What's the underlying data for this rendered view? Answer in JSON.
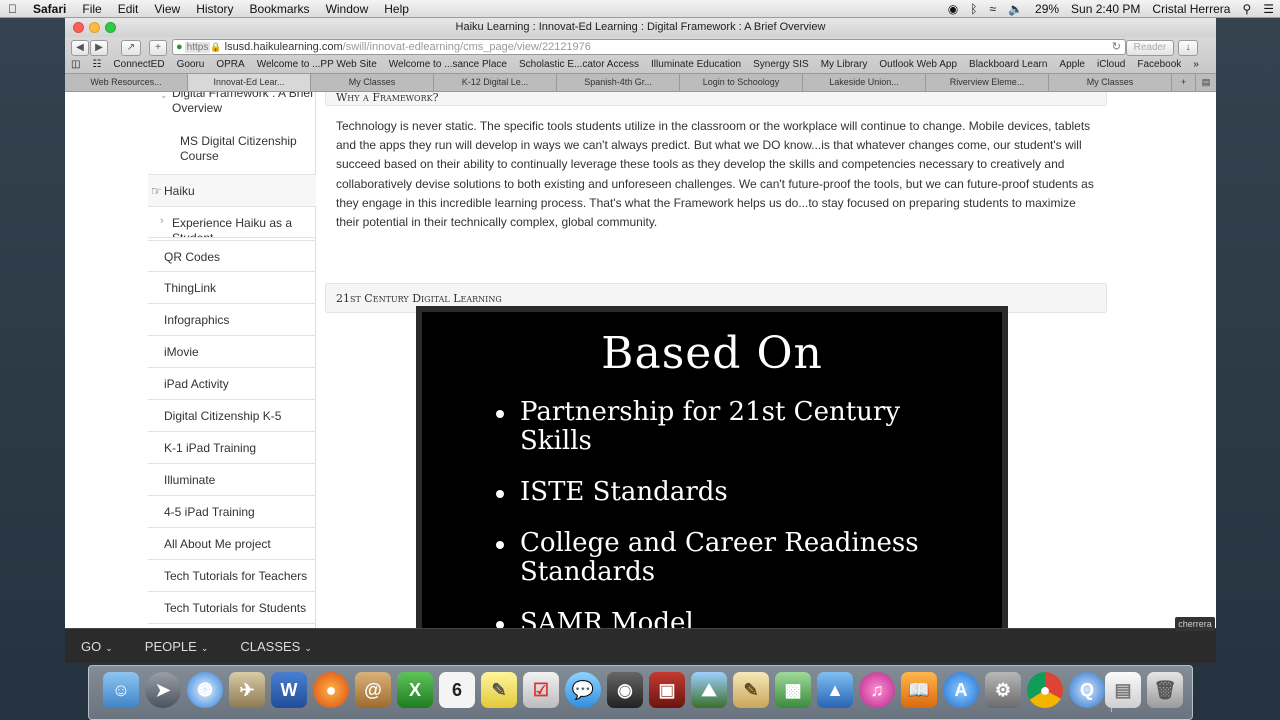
{
  "menubar": {
    "app": "Safari",
    "items": [
      "File",
      "Edit",
      "View",
      "History",
      "Bookmarks",
      "Window",
      "Help"
    ],
    "battery": "29%",
    "clock": "Sun 2:40 PM",
    "user": "Cristal Herrera"
  },
  "window": {
    "title": "Haiku Learning : Innovat-Ed Learning : Digital Framework : A Brief Overview",
    "url_scheme": "https",
    "url_host": "lsusd.haikulearning.com",
    "url_path": "/swill/innovat-edlearning/cms_page/view/22121976",
    "reader_label": "Reader"
  },
  "bookmarks": [
    "ConnectED",
    "Gooru",
    "OPRA",
    "Welcome to ...PP Web Site",
    "Welcome to ...sance Place",
    "Scholastic E...cator Access",
    "Illuminate Education",
    "Synergy SIS",
    "My Library",
    "Outlook Web App",
    "Blackboard Learn",
    "Apple",
    "iCloud",
    "Facebook"
  ],
  "tabs": [
    "Web Resources...",
    "Innovat-Ed Lear...",
    "My Classes",
    "K-12 Digital Le...",
    "Spanish-4th Gr...",
    "Login to Schoology",
    "Lakeside Union...",
    "Riverview Eleme...",
    "My Classes"
  ],
  "nav": {
    "items": [
      "Digital Framework : A Brief Overview",
      "MS Digital Citizenship Course",
      "Haiku",
      "Experience Haiku as a Student",
      "QR Codes",
      "ThingLink",
      "Infographics",
      "iMovie",
      "iPad Activity",
      "Digital Citizenship K-5",
      "K-1 iPad Training",
      "Illuminate",
      "4-5 iPad Training",
      "All About Me project",
      "Tech Tutorials for Teachers",
      "Tech Tutorials for Students"
    ]
  },
  "main": {
    "section1_title": "Why a Framework?",
    "paragraph": "Technology is never static.  The specific tools students utilize in the classroom or the workplace will continue to change. Mobile devices, tablets and the apps they run will develop in ways we can't always predict.  But what we DO know...is that whatever changes come, our student's will succeed based on their ability to continually leverage these tools as they develop the skills and competencies necessary to creatively and collaboratively devise solutions to both existing and unforeseen challenges.  We can't future-proof the tools, but we can future-proof students as they engage in this incredible learning process. That's what the Framework helps us do...to stay focused on preparing students to maximize their potential in their technically complex, global community.",
    "section2_title": "21st Century Digital Learning",
    "slide": {
      "heading": "Based On",
      "bullets": [
        "Partnership for 21st Century Skills",
        "ISTE Standards",
        "College and Career Readiness Standards",
        "SAMR Model"
      ]
    }
  },
  "bottombar": {
    "go": "GO",
    "people": "PEOPLE",
    "classes": "CLASSES",
    "user_tag": "cherrera"
  },
  "dock": {
    "calendar_day": "6"
  },
  "colors": {
    "panel_bg": "#f5f5f5",
    "slide_bg": "#000000",
    "bottombar_bg": "#2b2b2b"
  }
}
